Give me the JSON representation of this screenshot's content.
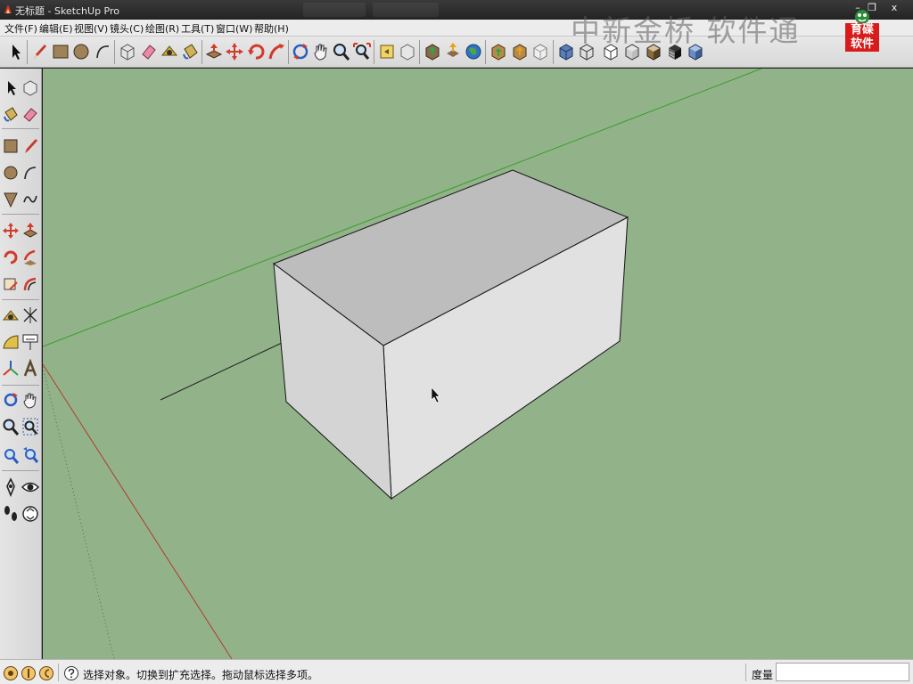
{
  "window": {
    "title": "无标题 - SketchUp Pro",
    "minimize_glyph": "–",
    "restore_glyph": "❐",
    "close_glyph": "x"
  },
  "menu": [
    {
      "label": "文件(F)"
    },
    {
      "label": "编辑(E)"
    },
    {
      "label": "视图(V)"
    },
    {
      "label": "镜头(C)"
    },
    {
      "label": "绘图(R)"
    },
    {
      "label": "工具(T)"
    },
    {
      "label": "窗口(W)"
    },
    {
      "label": "帮助(H)"
    }
  ],
  "watermark": {
    "text": "中新金桥 软件通",
    "logo_line1": "育碟",
    "logo_line2": "软件"
  },
  "toolbar": {
    "tools": [
      {
        "name": "select",
        "icon": "arrow-icon"
      },
      {
        "name": "line",
        "icon": "pencil-icon"
      },
      {
        "name": "rectangle",
        "icon": "rectangle-icon"
      },
      {
        "name": "circle",
        "icon": "circle-icon"
      },
      {
        "name": "arc",
        "icon": "arc-icon"
      },
      {
        "name": "make-component",
        "icon": "component-icon"
      },
      {
        "name": "eraser",
        "icon": "eraser-icon"
      },
      {
        "name": "tape-measure",
        "icon": "tape-icon"
      },
      {
        "name": "paint-bucket",
        "icon": "bucket-icon"
      },
      {
        "name": "push-pull",
        "icon": "pushpull-icon"
      },
      {
        "name": "move",
        "icon": "move-icon"
      },
      {
        "name": "rotate",
        "icon": "rotate-icon"
      },
      {
        "name": "follow-me",
        "icon": "followme-icon"
      },
      {
        "name": "orbit",
        "icon": "orbit-icon"
      },
      {
        "name": "pan",
        "icon": "hand-icon"
      },
      {
        "name": "zoom",
        "icon": "zoom-icon"
      },
      {
        "name": "zoom-extents",
        "icon": "zoom-extents-icon"
      },
      {
        "name": "previous-view",
        "icon": "previous-view-icon"
      },
      {
        "name": "next-view",
        "icon": "next-view-icon"
      },
      {
        "name": "get-models",
        "icon": "warehouse-icon"
      },
      {
        "name": "share-model",
        "icon": "share-icon"
      },
      {
        "name": "google-earth",
        "icon": "earth-icon"
      },
      {
        "name": "get-components",
        "icon": "get-components-icon"
      },
      {
        "name": "share-components",
        "icon": "share-components-icon"
      },
      {
        "name": "extension-warehouse",
        "icon": "extension-icon"
      },
      {
        "name": "xray",
        "icon": "xray-icon"
      },
      {
        "name": "wireframe",
        "icon": "wireframe-icon"
      },
      {
        "name": "hidden-line",
        "icon": "hidden-line-icon"
      },
      {
        "name": "shaded",
        "icon": "shaded-icon"
      },
      {
        "name": "shaded-textures",
        "icon": "textured-icon"
      },
      {
        "name": "monochrome",
        "icon": "monochrome-icon"
      },
      {
        "name": "iso-view",
        "icon": "iso-view-icon"
      }
    ]
  },
  "left_toolbar": {
    "tools": [
      {
        "name": "select",
        "icon": "arrow-icon"
      },
      {
        "name": "make-component",
        "icon": "component-icon"
      },
      {
        "name": "paint-bucket",
        "icon": "bucket-icon"
      },
      {
        "name": "eraser",
        "icon": "eraser-icon"
      },
      {
        "name": "rectangle",
        "icon": "rectangle-icon"
      },
      {
        "name": "line",
        "icon": "pencil-icon"
      },
      {
        "name": "circle",
        "icon": "circle-icon"
      },
      {
        "name": "arc",
        "icon": "arc-icon"
      },
      {
        "name": "polygon",
        "icon": "polygon-icon"
      },
      {
        "name": "freehand",
        "icon": "freehand-icon"
      },
      {
        "name": "move",
        "icon": "move-icon"
      },
      {
        "name": "push-pull",
        "icon": "pushpull-icon"
      },
      {
        "name": "rotate",
        "icon": "rotate-icon"
      },
      {
        "name": "follow-me",
        "icon": "followme-icon"
      },
      {
        "name": "scale",
        "icon": "scale-icon"
      },
      {
        "name": "offset",
        "icon": "offset-icon"
      },
      {
        "name": "tape-measure",
        "icon": "tape-icon"
      },
      {
        "name": "dimension",
        "icon": "dimension-icon"
      },
      {
        "name": "protractor",
        "icon": "protractor-icon"
      },
      {
        "name": "text",
        "icon": "text-icon"
      },
      {
        "name": "axes",
        "icon": "axes-icon"
      },
      {
        "name": "3d-text",
        "icon": "3d-text-icon"
      },
      {
        "name": "orbit",
        "icon": "orbit-icon"
      },
      {
        "name": "pan",
        "icon": "hand-icon"
      },
      {
        "name": "zoom",
        "icon": "zoom-icon"
      },
      {
        "name": "zoom-window",
        "icon": "zoom-window-icon"
      },
      {
        "name": "zoom-extents",
        "icon": "zoom-extents-icon"
      },
      {
        "name": "previous-view",
        "icon": "previous-view-icon"
      },
      {
        "name": "position-camera",
        "icon": "camera-icon"
      },
      {
        "name": "look-around",
        "icon": "eye-icon"
      },
      {
        "name": "walk",
        "icon": "footprints-icon"
      },
      {
        "name": "section-plane",
        "icon": "section-icon"
      }
    ]
  },
  "status": {
    "hint": "选择对象。切换到扩充选择。拖动鼠标选择多项。",
    "measure_label": "度量",
    "measure_value": ""
  },
  "colors": {
    "viewport_bg": "#92b38a",
    "green_axis": "#3b9a2c",
    "red_axis": "#b23a2c",
    "box_top": "#bdbdbd",
    "box_right": "#e1e1e1",
    "box_left": "#d4d4d4"
  }
}
